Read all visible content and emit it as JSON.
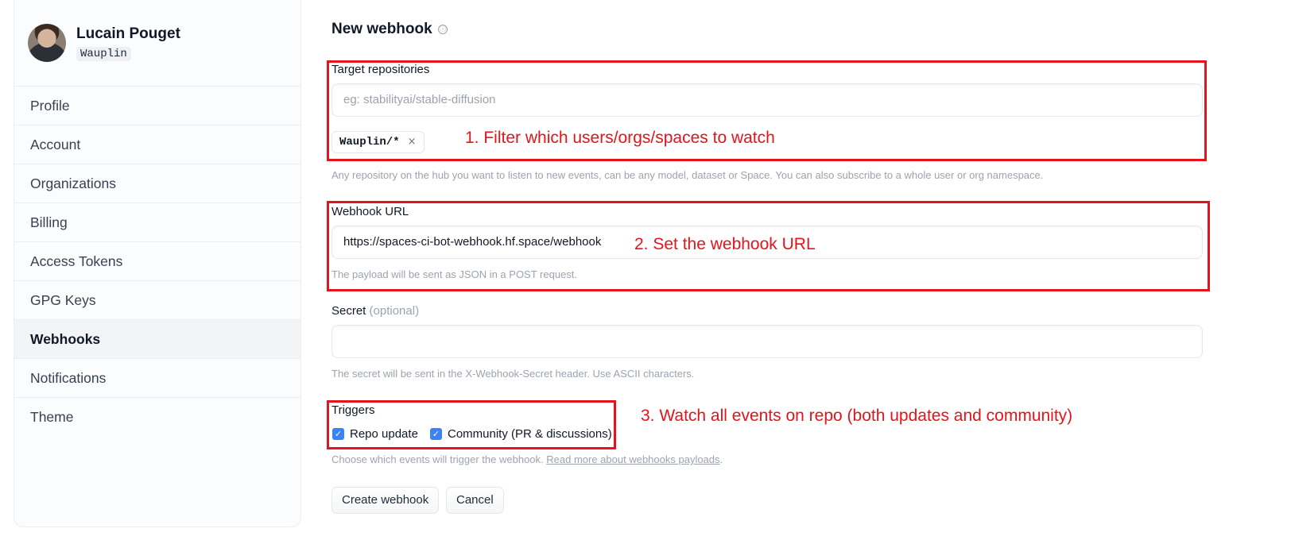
{
  "sidebar": {
    "user_name": "Lucain Pouget",
    "user_handle": "Wauplin",
    "items": [
      {
        "label": "Profile"
      },
      {
        "label": "Account"
      },
      {
        "label": "Organizations"
      },
      {
        "label": "Billing"
      },
      {
        "label": "Access Tokens"
      },
      {
        "label": "GPG Keys"
      },
      {
        "label": "Webhooks",
        "active": true
      },
      {
        "label": "Notifications"
      },
      {
        "label": "Theme"
      }
    ]
  },
  "form": {
    "title": "New webhook",
    "info_icon": "ⓘ",
    "target_repos": {
      "label": "Target repositories",
      "placeholder": "eg: stabilityai/stable-diffusion",
      "tag": "Wauplin/*",
      "tag_remove": "×",
      "help": "Any repository on the hub you want to listen to new events, can be any model, dataset or Space. You can also subscribe to a whole user or org namespace."
    },
    "webhook_url": {
      "label": "Webhook URL",
      "value": "https://spaces-ci-bot-webhook.hf.space/webhook",
      "help": "The payload will be sent as JSON in a POST request."
    },
    "secret": {
      "label": "Secret",
      "optional": "(optional)",
      "value": "",
      "help": "The secret will be sent in the X-Webhook-Secret header. Use ASCII characters."
    },
    "triggers": {
      "label": "Triggers",
      "repo_update": "Repo update",
      "community": "Community (PR & discussions)",
      "check_glyph": "✓",
      "help_prefix": "Choose which events will trigger the webhook.",
      "help_link": "Read more about webhooks payloads",
      "help_suffix": "."
    },
    "create_button": "Create webhook",
    "cancel_button": "Cancel"
  },
  "annotations": {
    "step1": "1. Filter which users/orgs/spaces to watch",
    "step2": "2. Set the webhook URL",
    "step3": "3. Watch all events on repo (both updates and community)"
  },
  "colors": {
    "annotation": "#e3141b",
    "checkbox": "#3b82f6"
  }
}
